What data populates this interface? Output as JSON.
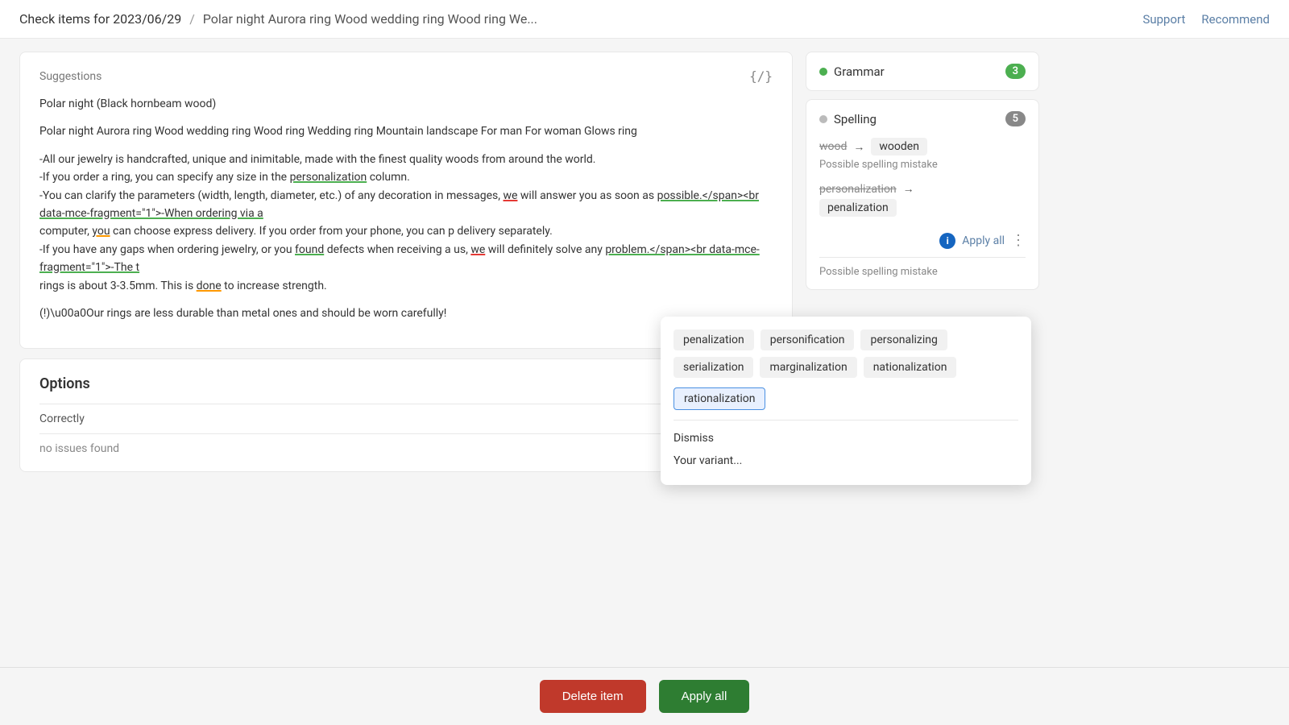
{
  "header": {
    "title": "Check items for 2023/06/29",
    "separator": "/",
    "subtitle": "Polar night Aurora ring Wood wedding ring Wood ring We...",
    "support_label": "Support",
    "recommend_label": "Recommend"
  },
  "suggestions_card": {
    "header_label": "Suggestions",
    "header_icon": "{/}",
    "paragraphs": [
      "Polar night (Black hornbeam wood)",
      "Polar night Aurora ring Wood wedding ring Wood ring Wedding ring Mountain landscape For man For woman Glows ring",
      "-All our jewelry is handcrafted, unique and inimitable, made with the finest quality woods from around the world.\n-If you order a ring, you can specify any size in the personalization column.\n-You can clarify the parameters (width, length, diameter, etc.) of any decoration in messages, we will answer you as soon as possible.</span><br data-mce-fragment=\"1\">-When ordering via a computer, you can choose express delivery. If you order from your phone, you can p delivery separately.\n-If you have any gaps when ordering jewelry, or you found defects when receiving a us, we will definitely solve any problem.</span><br data-mce-fragment=\"1\">-The t rings is about 3-3.5mm. This is done to increase strength.",
      "(!) Our rings are less durable than metal ones and should be worn carefully!"
    ]
  },
  "options_card": {
    "title": "Options",
    "label": "Correctly",
    "status": "no issues found"
  },
  "right_panel": {
    "grammar": {
      "label": "Grammar",
      "count": "3",
      "dot_color": "green"
    },
    "spelling": {
      "label": "Spelling",
      "count": "5",
      "dot_color": "gray"
    },
    "correction1": {
      "original": "wood",
      "replacement": "wooden",
      "note": "Possible spelling mistake"
    },
    "correction2": {
      "original": "personalization",
      "replacement": "penalization",
      "note": "Possible spelling mistake"
    },
    "apply_all_label": "Apply all",
    "info_label": "i"
  },
  "dropdown": {
    "chips": [
      {
        "label": "penalization",
        "selected": false
      },
      {
        "label": "personification",
        "selected": false
      },
      {
        "label": "personalizing",
        "selected": false
      },
      {
        "label": "serialization",
        "selected": false
      },
      {
        "label": "marginalization",
        "selected": false
      },
      {
        "label": "nationalization",
        "selected": false
      },
      {
        "label": "rationalization",
        "selected": true
      }
    ],
    "dismiss_label": "Dismiss",
    "variant_label": "Your variant..."
  },
  "bottom_bar": {
    "delete_label": "Delete item",
    "apply_label": "Apply all"
  }
}
